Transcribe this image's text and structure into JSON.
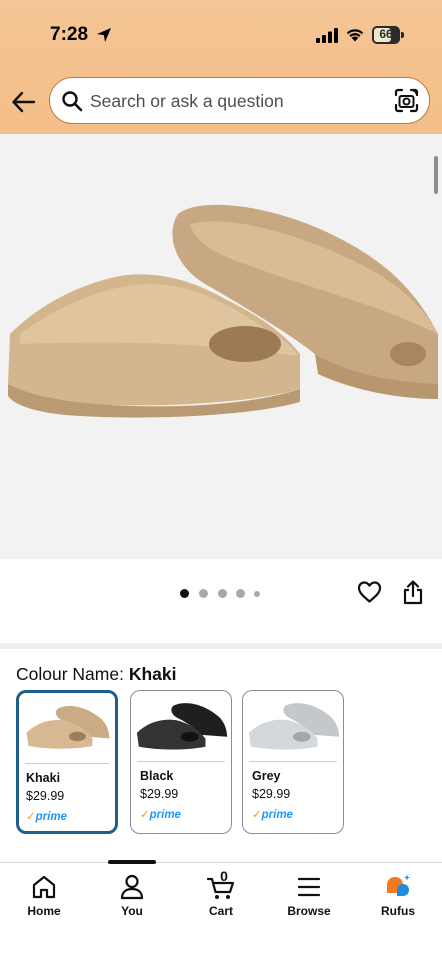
{
  "status_bar": {
    "time": "7:28",
    "battery_level": "66"
  },
  "header": {
    "search_placeholder": "Search or ask a question"
  },
  "product": {
    "image_alt": "Khaki slide sandals",
    "carousel": {
      "count": 5,
      "active_index": 0
    }
  },
  "variant": {
    "label": "Colour Name:",
    "selected": "Khaki",
    "options": [
      {
        "name": "Khaki",
        "price": "$29.99",
        "prime": "prime",
        "color": "#d2b48a",
        "selected": true
      },
      {
        "name": "Black",
        "price": "$29.99",
        "prime": "prime",
        "color": "#2c2c2c",
        "selected": false
      },
      {
        "name": "Grey",
        "price": "$29.99",
        "prime": "prime",
        "color": "#cfd3d6",
        "selected": false
      }
    ]
  },
  "bottom_nav": {
    "items": [
      {
        "label": "Home",
        "icon": "home-icon"
      },
      {
        "label": "You",
        "icon": "person-icon"
      },
      {
        "label": "Cart",
        "icon": "cart-icon",
        "count": "0"
      },
      {
        "label": "Browse",
        "icon": "menu-icon"
      },
      {
        "label": "Rufus",
        "icon": "rufus-icon"
      }
    ]
  },
  "colors": {
    "header": "#f4c28f",
    "accent": "#1f5f8b",
    "prime": "#1a98ff",
    "prime_check": "#f79a1d"
  }
}
